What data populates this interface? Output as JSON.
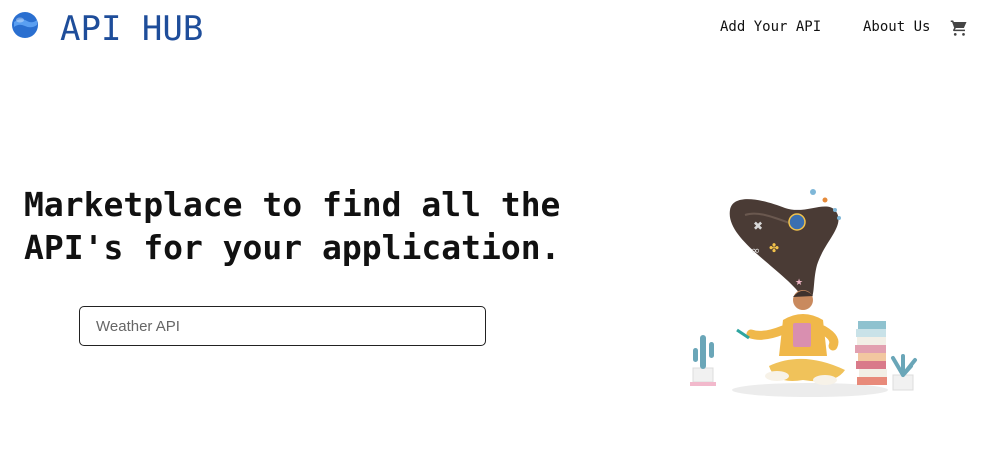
{
  "header": {
    "brand": "API HUB",
    "nav": [
      {
        "label": "Add Your API"
      },
      {
        "label": "About Us"
      }
    ],
    "cart_icon": "cart-icon",
    "logo_icon": "globe-icon"
  },
  "hero": {
    "headline_line1": "Marketplace to find all the",
    "headline_line2": "API's for your application.",
    "search": {
      "placeholder": "Weather API",
      "value": ""
    },
    "illustration": "person-meditating-illustration"
  },
  "colors": {
    "brand": "#1e4d9a",
    "text": "#111111",
    "background": "#ffffff"
  }
}
